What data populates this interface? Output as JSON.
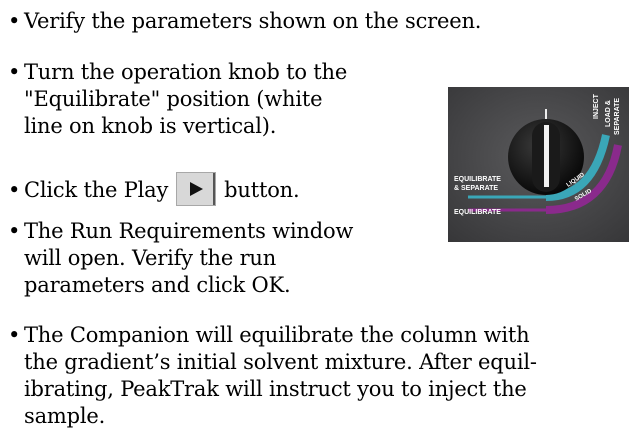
{
  "bullet_char": "•",
  "steps": [
    {
      "text": "Verify the parameters shown on the screen."
    },
    {
      "text": "Turn the operation knob to the\n\"Equilibrate\" position (white\nline on knob is vertical)."
    },
    {
      "before": "Click the Play",
      "after": "button.",
      "button_icon": "play-icon"
    },
    {
      "text": "The Run Requirements window\nwill open. Verify the run\nparameters and click OK."
    },
    {
      "text": "The Companion will equilibrate the column with\nthe gradient’s initial solvent mixture. After equil-\nibrating, PeakTrak will instruct you to inject the\nsample."
    }
  ],
  "knob_panel": {
    "labels": {
      "inject": "INJECT",
      "load_line1": "LOAD &",
      "load_line2": "SEPARATE",
      "eq_sep_line1": "EQUILIBRATE",
      "eq_sep_line2": "& SEPARATE",
      "equilibrate": "EQUILIBRATE",
      "liquid": "LIQUID",
      "solid": "SOLID"
    },
    "colors": {
      "panel": "#4a4a4c",
      "liquid_arc": "#3aa7b8",
      "solid_arc": "#8a2a8c",
      "text": "#ffffff"
    }
  }
}
